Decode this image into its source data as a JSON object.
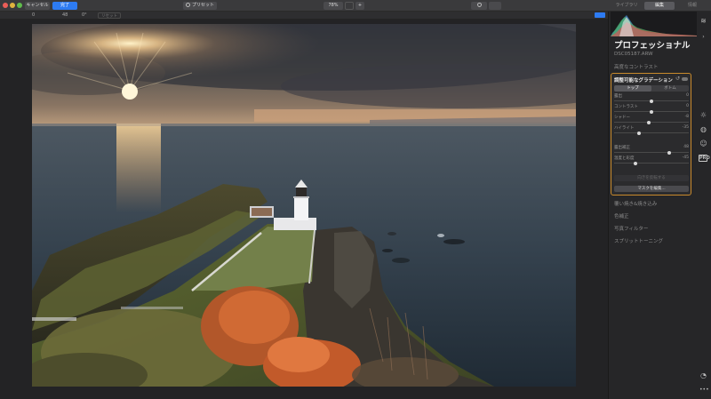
{
  "titlebar": {
    "cancel_label": "キャンセル",
    "apply_label": "完了",
    "preset_label": "プリセット",
    "zoom_label": "78%",
    "compare_icon": "eye-icon",
    "tabs": [
      {
        "label": "ライブラリ",
        "active": false
      },
      {
        "label": "編集",
        "active": true
      },
      {
        "label": "情報",
        "active": false
      }
    ]
  },
  "toolbar": {
    "val_exposure": "0",
    "val_size": "48",
    "val_angle": "0°",
    "reset_label": "リセット"
  },
  "panel": {
    "title": "プロフェッショナル",
    "filename": "DSC05187.ARW",
    "section_above": "高度なコントラスト",
    "gradient": {
      "title": "調整可能なグラデーション",
      "tabs": {
        "top": "トップ",
        "bottom": "ボトム"
      },
      "sliders": [
        {
          "label": "露出",
          "value": "0",
          "position": 0.5
        },
        {
          "label": "コントラスト",
          "value": "0",
          "position": 0.5
        },
        {
          "label": "シャドー",
          "value": "-8",
          "position": 0.46
        },
        {
          "label": "ハイライト",
          "value": "-35",
          "position": 0.33
        },
        {
          "label": "露出補正",
          "value": "48",
          "position": 0.74
        },
        {
          "label": "温度と彩度",
          "value": "-45",
          "position": 0.28
        }
      ],
      "dim_button": "向きを反転する",
      "mask_button": "マスクを編集..."
    },
    "sections_below": [
      "覆い焼き&焼き込み",
      "色補正",
      "写真フィルター",
      "スプリットトーニング"
    ]
  },
  "rail_icons": [
    "layers-icon",
    "sun-icon",
    "palette-icon",
    "face-icon",
    "pro-icon",
    "clock-icon",
    "more-icon"
  ],
  "rail_pro_label": "PRO",
  "colors": {
    "accent": "#2d7bf2",
    "highlight_border": "#c98a2c"
  }
}
